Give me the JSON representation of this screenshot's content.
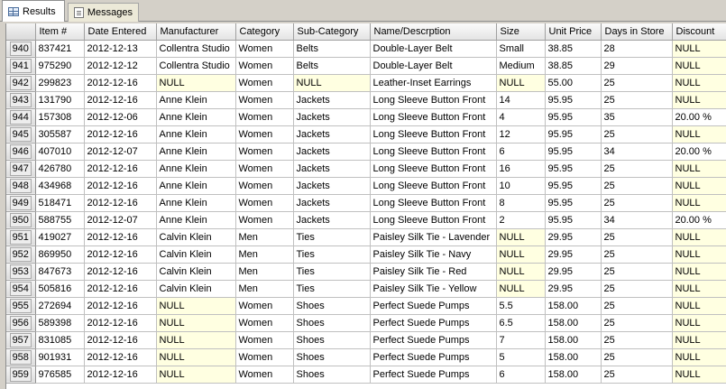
{
  "tabs": [
    {
      "label": "Results",
      "icon": "grid-icon",
      "active": true
    },
    {
      "label": "Messages",
      "icon": "messages-icon",
      "active": false
    }
  ],
  "columns": [
    "Item #",
    "Date Entered",
    "Manufacturer",
    "Category",
    "Sub-Category",
    "Name/Descrption",
    "Size",
    "Unit Price",
    "Days in Store",
    "Discount"
  ],
  "rows": [
    {
      "num": "940",
      "cells": [
        "837421",
        "2012-12-13",
        "Collentra Studio",
        "Women",
        "Belts",
        "Double-Layer Belt",
        "Small",
        "38.85",
        "28",
        "NULL"
      ]
    },
    {
      "num": "941",
      "cells": [
        "975290",
        "2012-12-12",
        "Collentra Studio",
        "Women",
        "Belts",
        "Double-Layer Belt",
        "Medium",
        "38.85",
        "29",
        "NULL"
      ]
    },
    {
      "num": "942",
      "cells": [
        "299823",
        "2012-12-16",
        "NULL",
        "Women",
        "NULL",
        "Leather-Inset Earrings",
        "NULL",
        "55.00",
        "25",
        "NULL"
      ]
    },
    {
      "num": "943",
      "cells": [
        "131790",
        "2012-12-16",
        "Anne Klein",
        "Women",
        "Jackets",
        "Long Sleeve Button Front",
        "14",
        "95.95",
        "25",
        "NULL"
      ]
    },
    {
      "num": "944",
      "cells": [
        "157308",
        "2012-12-06",
        "Anne Klein",
        "Women",
        "Jackets",
        "Long Sleeve Button Front",
        "4",
        "95.95",
        "35",
        "20.00 %"
      ]
    },
    {
      "num": "945",
      "cells": [
        "305587",
        "2012-12-16",
        "Anne Klein",
        "Women",
        "Jackets",
        "Long Sleeve Button Front",
        "12",
        "95.95",
        "25",
        "NULL"
      ]
    },
    {
      "num": "946",
      "cells": [
        "407010",
        "2012-12-07",
        "Anne Klein",
        "Women",
        "Jackets",
        "Long Sleeve Button Front",
        "6",
        "95.95",
        "34",
        "20.00 %"
      ]
    },
    {
      "num": "947",
      "cells": [
        "426780",
        "2012-12-16",
        "Anne Klein",
        "Women",
        "Jackets",
        "Long Sleeve Button Front",
        "16",
        "95.95",
        "25",
        "NULL"
      ]
    },
    {
      "num": "948",
      "cells": [
        "434968",
        "2012-12-16",
        "Anne Klein",
        "Women",
        "Jackets",
        "Long Sleeve Button Front",
        "10",
        "95.95",
        "25",
        "NULL"
      ]
    },
    {
      "num": "949",
      "cells": [
        "518471",
        "2012-12-16",
        "Anne Klein",
        "Women",
        "Jackets",
        "Long Sleeve Button Front",
        "8",
        "95.95",
        "25",
        "NULL"
      ]
    },
    {
      "num": "950",
      "cells": [
        "588755",
        "2012-12-07",
        "Anne Klein",
        "Women",
        "Jackets",
        "Long Sleeve Button Front",
        "2",
        "95.95",
        "34",
        "20.00 %"
      ]
    },
    {
      "num": "951",
      "cells": [
        "419027",
        "2012-12-16",
        "Calvin Klein",
        "Men",
        "Ties",
        "Paisley Silk Tie - Lavender",
        "NULL",
        "29.95",
        "25",
        "NULL"
      ]
    },
    {
      "num": "952",
      "cells": [
        "869950",
        "2012-12-16",
        "Calvin Klein",
        "Men",
        "Ties",
        "Paisley Silk Tie - Navy",
        "NULL",
        "29.95",
        "25",
        "NULL"
      ]
    },
    {
      "num": "953",
      "cells": [
        "847673",
        "2012-12-16",
        "Calvin Klein",
        "Men",
        "Ties",
        "Paisley Silk Tie - Red",
        "NULL",
        "29.95",
        "25",
        "NULL"
      ]
    },
    {
      "num": "954",
      "cells": [
        "505816",
        "2012-12-16",
        "Calvin Klein",
        "Men",
        "Ties",
        "Paisley Silk Tie - Yellow",
        "NULL",
        "29.95",
        "25",
        "NULL"
      ]
    },
    {
      "num": "955",
      "cells": [
        "272694",
        "2012-12-16",
        "NULL",
        "Women",
        "Shoes",
        "Perfect Suede Pumps",
        "5.5",
        "158.00",
        "25",
        "NULL"
      ]
    },
    {
      "num": "956",
      "cells": [
        "589398",
        "2012-12-16",
        "NULL",
        "Women",
        "Shoes",
        "Perfect Suede Pumps",
        "6.5",
        "158.00",
        "25",
        "NULL"
      ]
    },
    {
      "num": "957",
      "cells": [
        "831085",
        "2012-12-16",
        "NULL",
        "Women",
        "Shoes",
        "Perfect Suede Pumps",
        "7",
        "158.00",
        "25",
        "NULL"
      ]
    },
    {
      "num": "958",
      "cells": [
        "901931",
        "2012-12-16",
        "NULL",
        "Women",
        "Shoes",
        "Perfect Suede Pumps",
        "5",
        "158.00",
        "25",
        "NULL"
      ]
    },
    {
      "num": "959",
      "cells": [
        "976585",
        "2012-12-16",
        "NULL",
        "Women",
        "Shoes",
        "Perfect Suede Pumps",
        "6",
        "158.00",
        "25",
        "NULL"
      ]
    }
  ],
  "colors": {
    "null_cell": "#ffffe1",
    "header_bg": "#e4e4e4",
    "window_bg": "#d4d0c8"
  }
}
